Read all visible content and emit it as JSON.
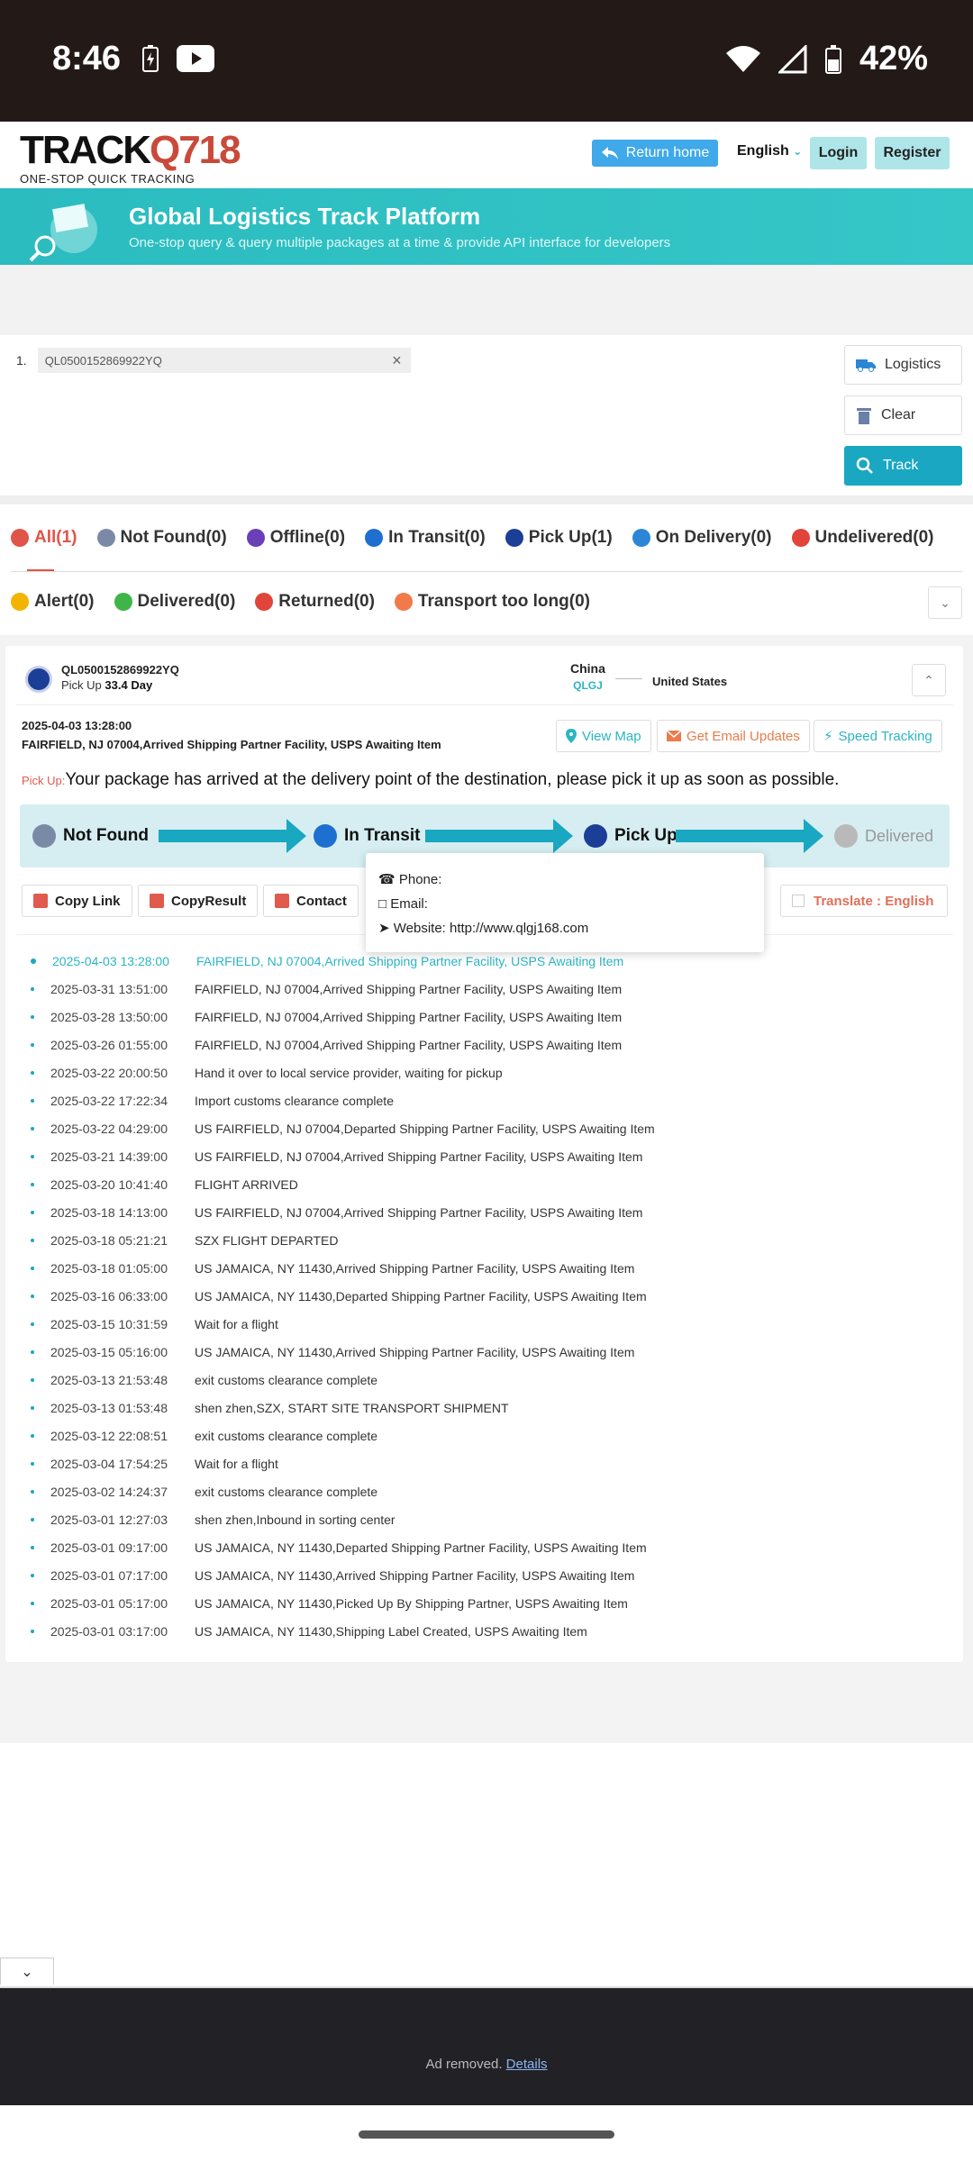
{
  "status_bar": {
    "time": "8:46",
    "battery": "42%"
  },
  "header": {
    "logo_main_a": "TRACK",
    "logo_main_b": "Q718",
    "logo_sub": "ONE-STOP QUICK TRACKING",
    "return_home": "Return home",
    "language": "English",
    "login": "Login",
    "register": "Register"
  },
  "banner": {
    "title": "Global Logistics Track Platform",
    "subtitle": "One-stop query & query multiple packages at a time & provide API interface for developers"
  },
  "track_form": {
    "row_number": "1.",
    "tracking_number": "QL0500152869922YQ",
    "logistics_btn": "Logistics",
    "clear_btn": "Clear",
    "track_btn": "Track"
  },
  "tabs": {
    "row1": [
      {
        "label": "All(1)",
        "color": "#e0544a"
      },
      {
        "label": "Not Found(0)",
        "color": "#7a8aa6"
      },
      {
        "label": "Offline(0)",
        "color": "#6a3fb8"
      },
      {
        "label": "In Transit(0)",
        "color": "#1e6fd0"
      },
      {
        "label": "Pick Up(1)",
        "color": "#1b3e96"
      },
      {
        "label": "On Delivery(0)",
        "color": "#2b86d6"
      },
      {
        "label": "Undelivered(0)",
        "color": "#e0443a"
      }
    ],
    "row2": [
      {
        "label": "Alert(0)",
        "color": "#f2b400"
      },
      {
        "label": "Delivered(0)",
        "color": "#3fb549"
      },
      {
        "label": "Returned(0)",
        "color": "#e0443a"
      },
      {
        "label": "Transport too long(0)",
        "color": "#f07a4a"
      }
    ]
  },
  "card": {
    "tracking_number": "QL0500152869922YQ",
    "status": "Pick Up",
    "days": "33.4 Day",
    "origin": "China",
    "carrier": "QLGJ",
    "destination": "United States",
    "latest_date": "2025-04-03 13:28:00",
    "latest_location": "FAIRFIELD, NJ 07004,Arrived Shipping Partner Facility, USPS Awaiting Item",
    "view_map": "View Map",
    "email_updates": "Get Email Updates",
    "speed_tracking": "Speed Tracking",
    "pickup_label": "Pick Up:",
    "pickup_message": "Your package has arrived at the delivery point of the destination, please pick it up as soon as possible.",
    "steps": [
      "Not Found",
      "In Transit",
      "Pick Up",
      "Delivered"
    ],
    "copy_link": "Copy Link",
    "copy_result": "CopyResult",
    "contact": "Contact",
    "translate": "Translate : English",
    "popup": {
      "phone": "Phone:",
      "email": "Email:",
      "website": "Website: http://www.qlgj168.com"
    }
  },
  "events": [
    {
      "time": "2025-04-03 13:28:00",
      "desc": "FAIRFIELD, NJ 07004,Arrived Shipping Partner Facility, USPS Awaiting Item"
    },
    {
      "time": "2025-03-31 13:51:00",
      "desc": "FAIRFIELD, NJ 07004,Arrived Shipping Partner Facility, USPS Awaiting Item"
    },
    {
      "time": "2025-03-28 13:50:00",
      "desc": "FAIRFIELD, NJ 07004,Arrived Shipping Partner Facility, USPS Awaiting Item"
    },
    {
      "time": "2025-03-26 01:55:00",
      "desc": "FAIRFIELD, NJ 07004,Arrived Shipping Partner Facility, USPS Awaiting Item"
    },
    {
      "time": "2025-03-22 20:00:50",
      "desc": "Hand it over to local service provider, waiting for pickup"
    },
    {
      "time": "2025-03-22 17:22:34",
      "desc": "Import customs clearance complete"
    },
    {
      "time": "2025-03-22 04:29:00",
      "desc": "US FAIRFIELD, NJ 07004,Departed Shipping Partner Facility, USPS Awaiting Item"
    },
    {
      "time": "2025-03-21 14:39:00",
      "desc": "US FAIRFIELD, NJ 07004,Arrived Shipping Partner Facility, USPS Awaiting Item"
    },
    {
      "time": "2025-03-20 10:41:40",
      "desc": "FLIGHT ARRIVED"
    },
    {
      "time": "2025-03-18 14:13:00",
      "desc": "US FAIRFIELD, NJ 07004,Arrived Shipping Partner Facility, USPS Awaiting Item"
    },
    {
      "time": "2025-03-18 05:21:21",
      "desc": "SZX FLIGHT DEPARTED"
    },
    {
      "time": "2025-03-18 01:05:00",
      "desc": "US JAMAICA, NY 11430,Arrived Shipping Partner Facility, USPS Awaiting Item"
    },
    {
      "time": "2025-03-16 06:33:00",
      "desc": "US JAMAICA, NY 11430,Departed Shipping Partner Facility, USPS Awaiting Item"
    },
    {
      "time": "2025-03-15 10:31:59",
      "desc": "Wait for a flight"
    },
    {
      "time": "2025-03-15 05:16:00",
      "desc": "US JAMAICA, NY 11430,Arrived Shipping Partner Facility, USPS Awaiting Item"
    },
    {
      "time": "2025-03-13 21:53:48",
      "desc": "exit customs clearance complete"
    },
    {
      "time": "2025-03-13 01:53:48",
      "desc": "shen zhen,SZX, START SITE TRANSPORT SHIPMENT"
    },
    {
      "time": "2025-03-12 22:08:51",
      "desc": "exit customs clearance complete"
    },
    {
      "time": "2025-03-04 17:54:25",
      "desc": "Wait for a flight"
    },
    {
      "time": "2025-03-02 14:24:37",
      "desc": "exit customs clearance complete"
    },
    {
      "time": "2025-03-01 12:27:03",
      "desc": "shen zhen,Inbound in sorting center"
    },
    {
      "time": "2025-03-01 09:17:00",
      "desc": "US JAMAICA, NY 11430,Departed Shipping Partner Facility, USPS Awaiting Item"
    },
    {
      "time": "2025-03-01 07:17:00",
      "desc": "US JAMAICA, NY 11430,Arrived Shipping Partner Facility, USPS Awaiting Item"
    },
    {
      "time": "2025-03-01 05:17:00",
      "desc": "US JAMAICA, NY 11430,Picked Up By Shipping Partner, USPS Awaiting Item"
    },
    {
      "time": "2025-03-01 03:17:00",
      "desc": "US JAMAICA, NY 11430,Shipping Label Created, USPS Awaiting Item"
    }
  ],
  "ad": {
    "removed": "Ad removed.",
    "details": "Details"
  },
  "colors": {
    "accent": "#1aa7c1",
    "brand_red": "#c94a3a",
    "banner": "#2bbcbf"
  }
}
